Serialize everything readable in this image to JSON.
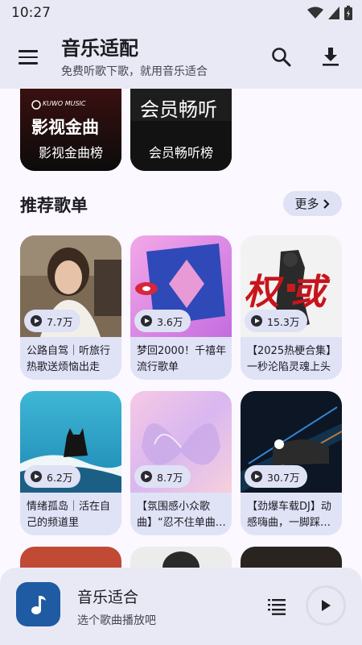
{
  "status_bar": {
    "time": "10:27"
  },
  "app_bar": {
    "title": "音乐适配",
    "subtitle": "免费听歌下歌，就用音乐适合"
  },
  "rankings": [
    {
      "label": "影视金曲榜",
      "art_brand": "KUWO MUSIC",
      "art_text": "影视金曲"
    },
    {
      "label": "会员畅听榜",
      "art_text": "会员畅听"
    }
  ],
  "recommend": {
    "title": "推荐歌单",
    "more_label": "更多"
  },
  "playlists": [
    {
      "name": "公路自驾｜听旅行热歌送烦恼出走",
      "plays": "7.7万"
    },
    {
      "name": "梦回2000！千禧年流行歌单",
      "plays": "3.6万"
    },
    {
      "name": "【2025热梗合集】一秒沦陷灵魂上头",
      "plays": "15.3万",
      "cover_text": "权或"
    },
    {
      "name": "情绪孤岛｜活在自己的频道里",
      "plays": "6.2万"
    },
    {
      "name": "【氛围感小众歌曲】“忍不住单曲循环”",
      "plays": "8.7万"
    },
    {
      "name": "【劲爆车载DJ】动感嗨曲，一脚踩到底",
      "plays": "30.7万"
    }
  ],
  "player": {
    "title": "音乐适合",
    "subtitle": "选个歌曲播放吧"
  },
  "colors": {
    "surface": "#e9e9f5",
    "background": "#fbf8ff",
    "card": "#e0e2f6",
    "chip": "#dfe1f4",
    "player_art": "#1f5ba3"
  }
}
